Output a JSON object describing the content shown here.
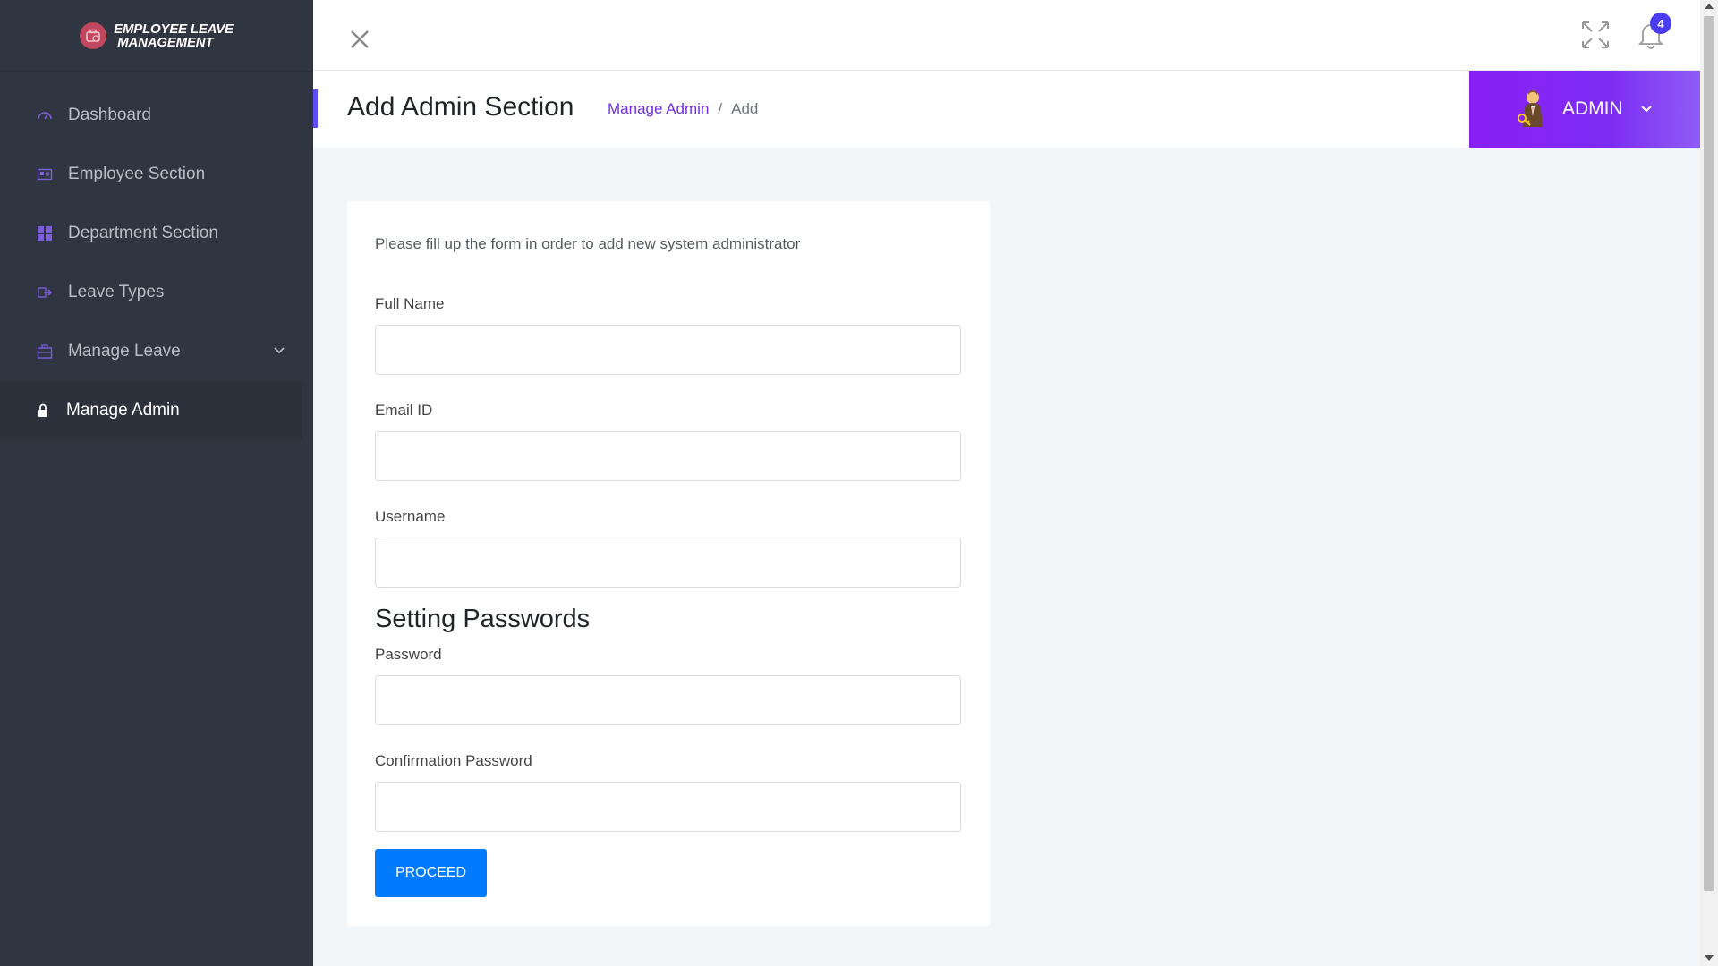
{
  "app": {
    "logo_line1": "Employee Leave",
    "logo_line2": "Management"
  },
  "sidebar": {
    "items": [
      {
        "label": "Dashboard",
        "icon": "dashboard-gauge-icon"
      },
      {
        "label": "Employee Section",
        "icon": "id-card-icon"
      },
      {
        "label": "Department Section",
        "icon": "grid-icon"
      },
      {
        "label": "Leave Types",
        "icon": "sign-out-icon"
      },
      {
        "label": "Manage Leave",
        "icon": "briefcase-icon",
        "expandable": true
      },
      {
        "label": "Manage Admin",
        "icon": "lock-icon",
        "active": true
      }
    ]
  },
  "topbar": {
    "notification_count": "4"
  },
  "header": {
    "title": "Add Admin Section",
    "breadcrumb_link": "Manage Admin",
    "breadcrumb_sep": "/",
    "breadcrumb_current": "Add"
  },
  "user": {
    "name": "ADMIN"
  },
  "form": {
    "intro": "Please fill up the form in order to add new system administrator",
    "full_name_label": "Full Name",
    "email_label": "Email ID",
    "username_label": "Username",
    "password_section_title": "Setting Passwords",
    "password_label": "Password",
    "confirm_password_label": "Confirmation Password",
    "submit_label": "PROCEED"
  },
  "colors": {
    "sidebar_bg": "#303641",
    "accent_purple": "#7d2cf3",
    "breadcrumb_link": "#6f2fe0",
    "primary_button": "#007bff",
    "badge": "#4a3cf0"
  }
}
